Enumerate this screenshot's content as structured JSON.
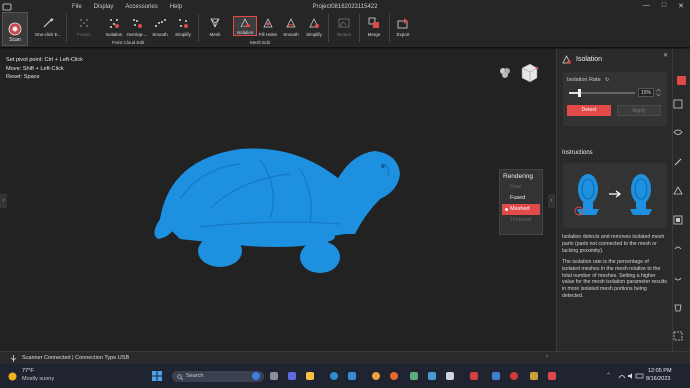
{
  "window": {
    "title": "Project08162023115422",
    "menu": [
      "File",
      "Display",
      "Accessories",
      "Help"
    ]
  },
  "toolbar": {
    "scan": "Scan",
    "one_click": "One-click E...",
    "fusion": "Fusion",
    "isolation_pc": "Isolation",
    "overlap": "Overlap-...",
    "smooth_pc": "Smooth",
    "simplify_pc": "Simplify",
    "group_point_cloud": "Point Cloud Edit",
    "mesh": "Mesh",
    "isolation_mesh": "Isolation",
    "fill_holes": "Fill Holes",
    "smooth_mesh": "Smooth",
    "simplify_mesh": "Simplify",
    "group_mesh": "Mesh Edit",
    "texture": "Texture",
    "merge": "Merge",
    "export": "Export"
  },
  "viewport": {
    "hints": [
      "Set pivot point: Ctrl + Left-Click",
      "Move: Shift + Left-Click",
      "Reset: Space"
    ],
    "rendering": {
      "heading": "Rendering",
      "options": [
        {
          "label": "Raw",
          "state": "disabled"
        },
        {
          "label": "Fused",
          "state": "enabled"
        },
        {
          "label": "Meshed",
          "state": "selected"
        },
        {
          "label": "Textured",
          "state": "disabled"
        }
      ]
    },
    "model_color": "#1e90e0"
  },
  "panel": {
    "title": "Isolation",
    "rate_label": "Isolation Rate",
    "rate_value": 15,
    "rate_text": "15%",
    "detect": "Detect",
    "apply": "Apply",
    "instructions_heading": "Instructions",
    "desc1": "Isolation detects and removes isolated mesh parts (parts not connected to the mesh or lacking proximity).",
    "desc2": "The isolation rate is the percentage of isolated meshes in the mesh relative to the total number of meshes. Setting a higher value for the mesh isolation parameter results in more isolated mesh portions being detected."
  },
  "status": {
    "text": "Scanner Connected | Connection Type USB"
  },
  "taskbar": {
    "temperature": "77°F",
    "weather": "Mostly sunny",
    "search": "Search",
    "time": "12:05 PM",
    "date": "8/16/2023"
  },
  "colors": {
    "accent": "#e24a4a",
    "model": "#1e90e0"
  }
}
